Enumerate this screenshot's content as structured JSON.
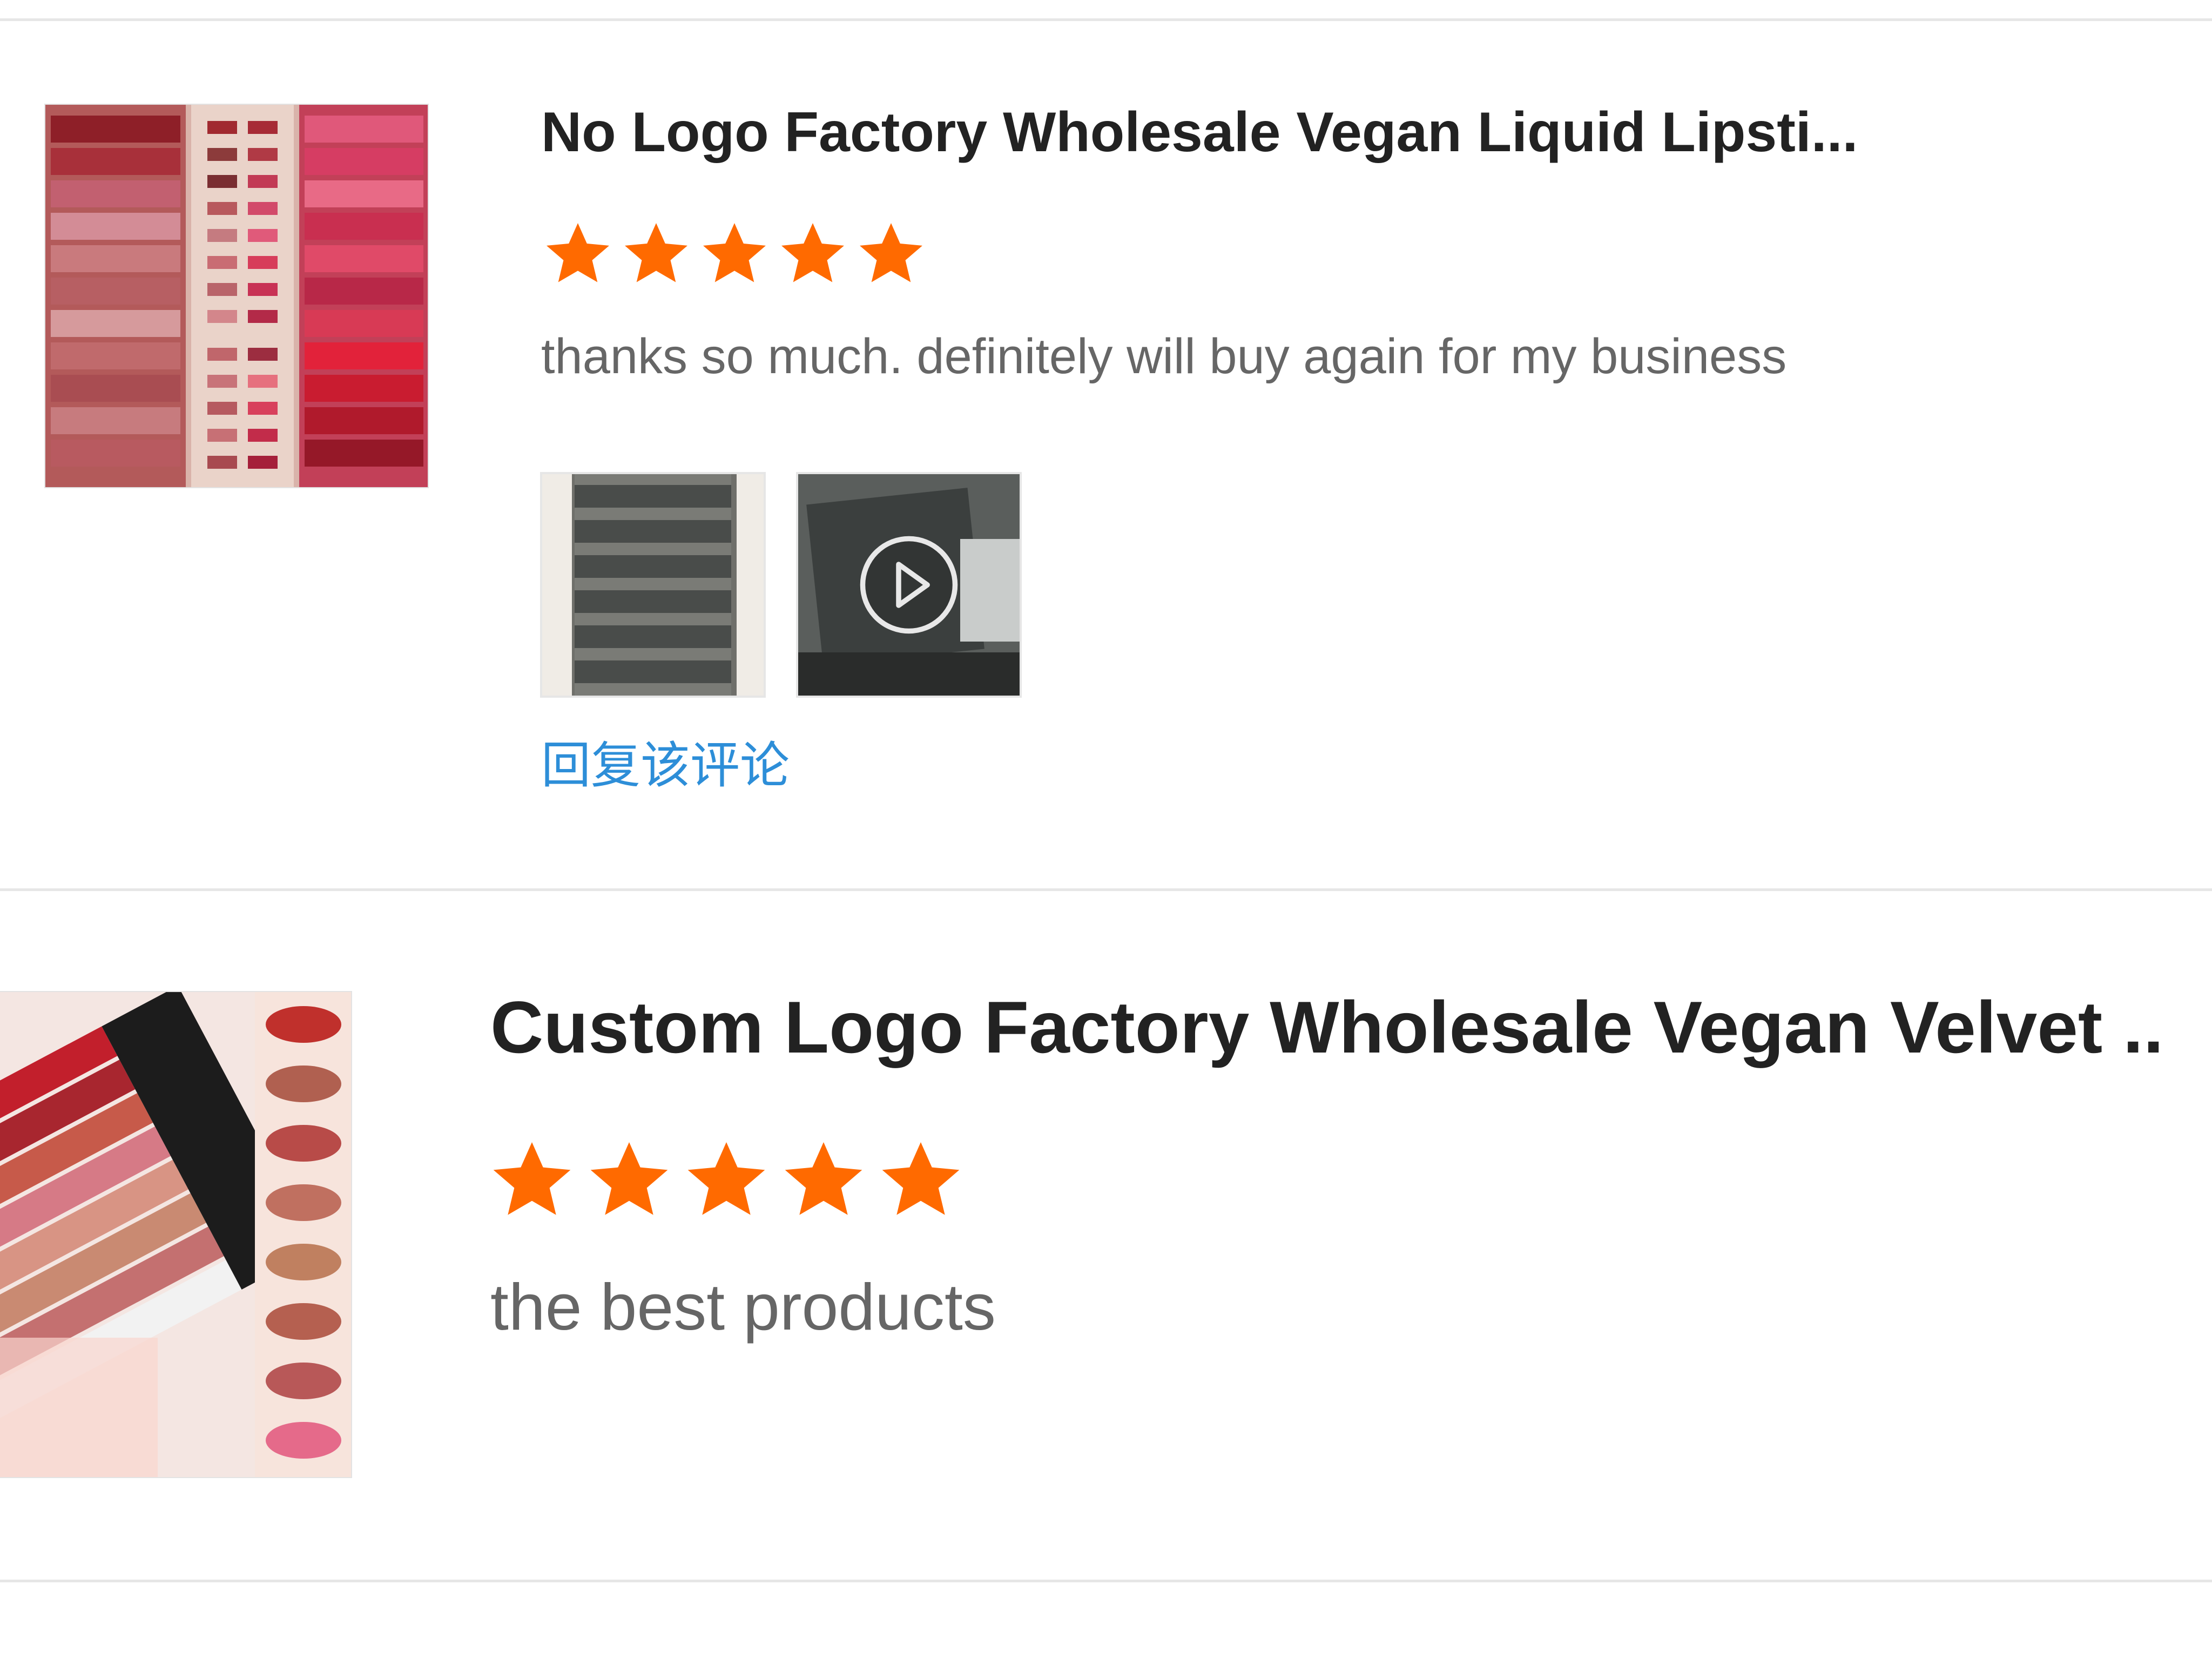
{
  "colors": {
    "star": "#ff6a00",
    "link": "#2d8ed8",
    "divider": "#e6e6e6"
  },
  "reviews": [
    {
      "product_title": "No Logo Factory Wholesale Vegan Liquid Lipsti...",
      "rating": 5,
      "rating_max": 5,
      "comment": "thanks so much. definitely will buy again for my business",
      "attachments": [
        {
          "kind": "photo",
          "icon": "photo-thumbnail"
        },
        {
          "kind": "video",
          "icon": "play-icon"
        }
      ],
      "reply_label": "回复该评论"
    },
    {
      "product_title": "Custom Logo Factory Wholesale Vegan Velvet ...",
      "rating": 5,
      "rating_max": 5,
      "comment": "the best products"
    }
  ]
}
